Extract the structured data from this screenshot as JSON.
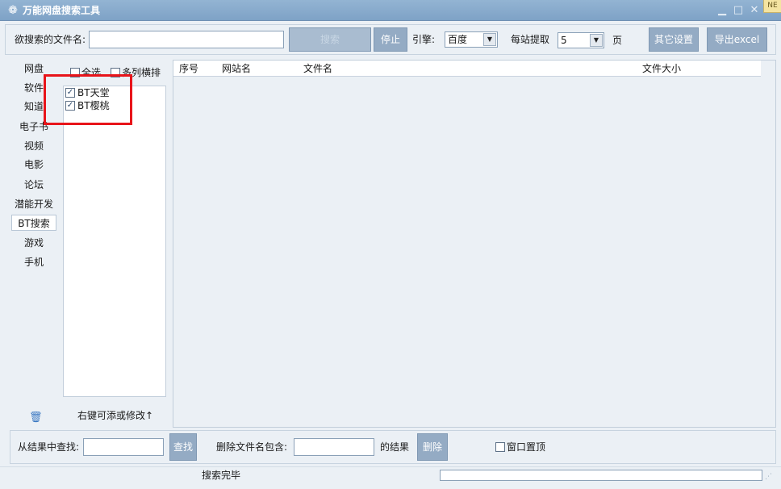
{
  "window": {
    "title": "万能网盘搜索工具",
    "corner_badge": "NE"
  },
  "toolbar": {
    "filename_label": "欲搜索的文件名:",
    "filename_value": "",
    "search_button": "搜索",
    "stop_button": "停止",
    "engine_label": "引擎:",
    "engine_value": "百度",
    "per_site_label": "每站提取",
    "per_site_value": "5",
    "page_unit": "页",
    "other_settings_button": "其它设置",
    "export_button": "导出excel"
  },
  "categories": [
    {
      "label": "网盘",
      "active": false
    },
    {
      "label": "软件",
      "active": false
    },
    {
      "label": "知道",
      "active": false
    },
    {
      "label": "电子书",
      "active": false
    },
    {
      "label": "视频",
      "active": false
    },
    {
      "label": "电影",
      "active": false
    },
    {
      "label": "论坛",
      "active": false
    },
    {
      "label": "潜能开发",
      "active": false
    },
    {
      "label": "BT搜索",
      "active": true
    },
    {
      "label": "游戏",
      "active": false
    },
    {
      "label": "手机",
      "active": false
    }
  ],
  "site_options": {
    "select_all": "全选",
    "multi_column": "多列横排"
  },
  "sites": [
    {
      "label": "BT天堂",
      "checked": true
    },
    {
      "label": "BT樱桃",
      "checked": true
    }
  ],
  "site_hint": "右键可添或修改↑",
  "grid": {
    "columns": [
      "序号",
      "网站名",
      "文件名",
      "文件大小"
    ]
  },
  "filter": {
    "find_label": "从结果中查找:",
    "find_value": "",
    "find_button": "查找",
    "delete_label": "删除文件名包含:",
    "delete_value": "",
    "result_suffix": "的结果",
    "delete_button": "删除",
    "pin_window": "窗口置顶",
    "pin_checked": false
  },
  "status": {
    "text": "搜索完毕",
    "progress": 0
  },
  "colors": {
    "accent": "#94abc4",
    "highlight_box": "#e8141a",
    "titlebar": "#7ea2c6"
  }
}
